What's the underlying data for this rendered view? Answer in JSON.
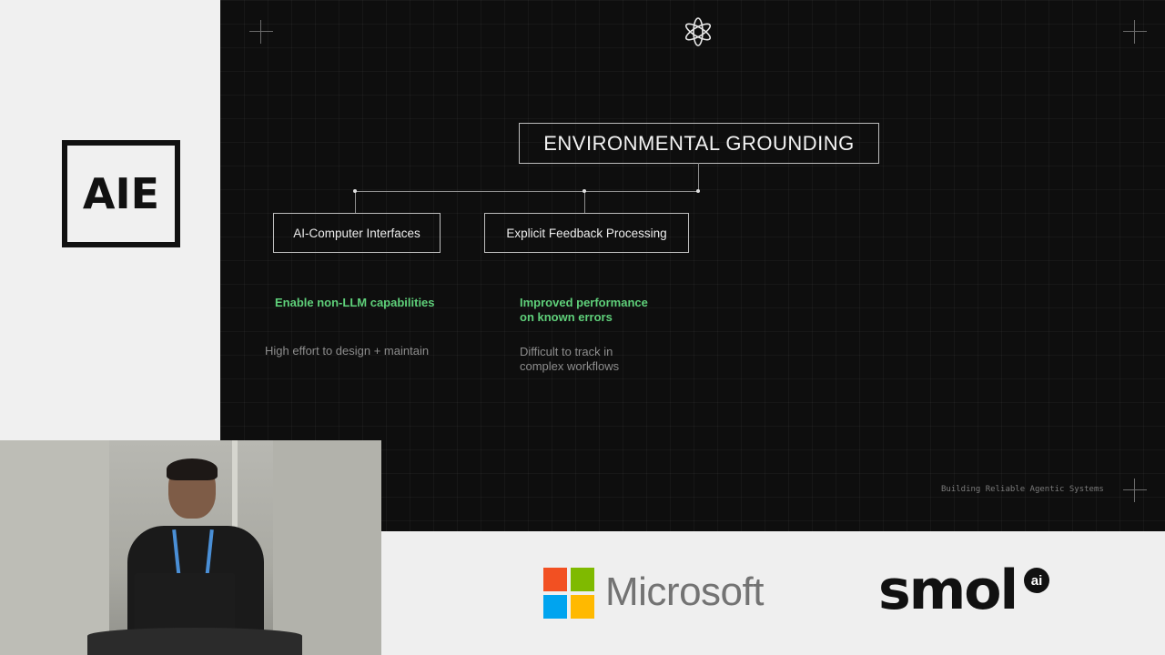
{
  "event_logo": {
    "text": "AIE"
  },
  "slide": {
    "title": "ENVIRONMENTAL GROUNDING",
    "branches": [
      {
        "label": "AI-Computer Interfaces",
        "pro": "Enable non-LLM capabilities",
        "con": "High effort to design + maintain"
      },
      {
        "label": "Explicit Feedback Processing",
        "pro": "Improved performance on known errors",
        "con": "Difficult to track in complex workflows"
      }
    ],
    "footer": "Building Reliable Agentic Systems",
    "logo_icon": "star-knot-icon",
    "colors": {
      "background": "#0e0e0e",
      "pro": "#5fd07a",
      "con": "#8d8d8d",
      "text": "#f3f3f3"
    }
  },
  "sponsors": {
    "microsoft": {
      "name": "Microsoft",
      "colors": [
        "#f25022",
        "#7fba00",
        "#00a4ef",
        "#ffb900"
      ]
    },
    "smol": {
      "name": "smol",
      "badge": "ai"
    }
  }
}
